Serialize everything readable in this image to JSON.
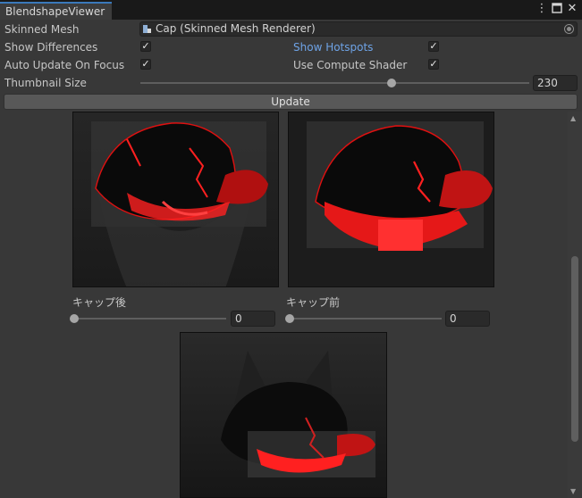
{
  "window": {
    "tab_title": "BlendshapeViewer",
    "menu_icon": "more-vertical-icon",
    "maximize_icon": "maximize-icon",
    "close_icon": "close-icon"
  },
  "fields": {
    "skinned_mesh": {
      "label": "Skinned Mesh",
      "value": "Cap (Skinned Mesh Renderer)",
      "icon": "skinned-mesh-icon"
    },
    "show_differences": {
      "label": "Show Differences",
      "checked": true
    },
    "show_hotspots": {
      "label": "Show Hotspots",
      "checked": true
    },
    "auto_update": {
      "label": "Auto Update On Focus",
      "checked": true
    },
    "use_compute_shader": {
      "label": "Use Compute Shader",
      "checked": true
    },
    "thumbnail_size": {
      "label": "Thumbnail Size",
      "value": "230"
    },
    "update_button": "Update"
  },
  "check_glyph": "✓",
  "blendshapes": [
    {
      "name": "キャップ後",
      "value": "0"
    },
    {
      "name": "キャップ前",
      "value": "0"
    }
  ],
  "colors": {
    "accent_tab": "#3a79bb",
    "hotspot_label": "#6ea3e6",
    "highlight_red": "#ff2020"
  }
}
